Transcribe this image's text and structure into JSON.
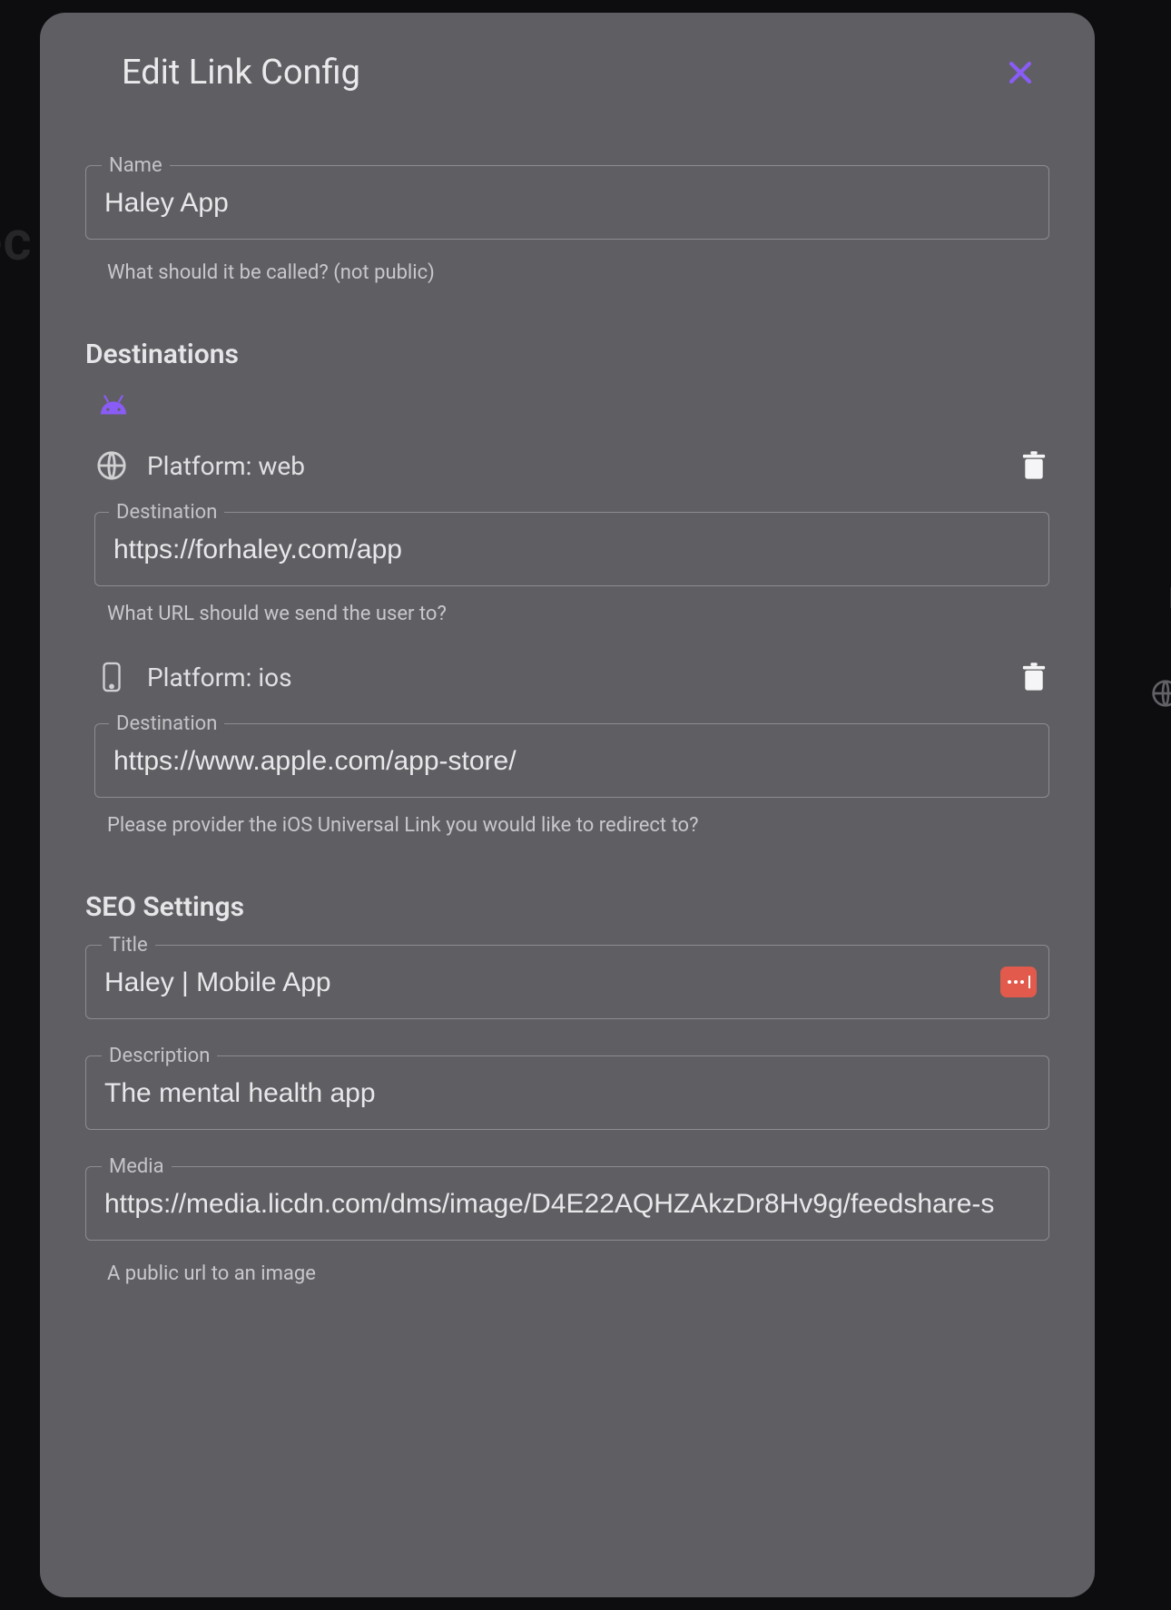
{
  "modal": {
    "title": "Edit Link Config"
  },
  "name_field": {
    "label": "Name",
    "value": "Haley App",
    "helper": "What should it be called? (not public)"
  },
  "destinations": {
    "heading": "Destinations",
    "dest_label": "Destination",
    "platforms": [
      {
        "key": "web",
        "label": "Platform: web",
        "value": "https://forhaley.com/app",
        "helper": "What URL should we send the user to?"
      },
      {
        "key": "ios",
        "label": "Platform: ios",
        "value": "https://www.apple.com/app-store/",
        "helper": "Please provider the iOS Universal Link you would like to redirect to?"
      }
    ]
  },
  "seo": {
    "heading": "SEO Settings",
    "title": {
      "label": "Title",
      "value": "Haley | Mobile App"
    },
    "description": {
      "label": "Description",
      "value": "The mental health app"
    },
    "media": {
      "label": "Media",
      "value": "https://media.licdn.com/dms/image/D4E22AQHZAkzDr8Hv9g/feedshare-s",
      "helper": "A public url to an image"
    }
  },
  "bg": {
    "left_fragment": "ec",
    "right_fragment": "D"
  }
}
